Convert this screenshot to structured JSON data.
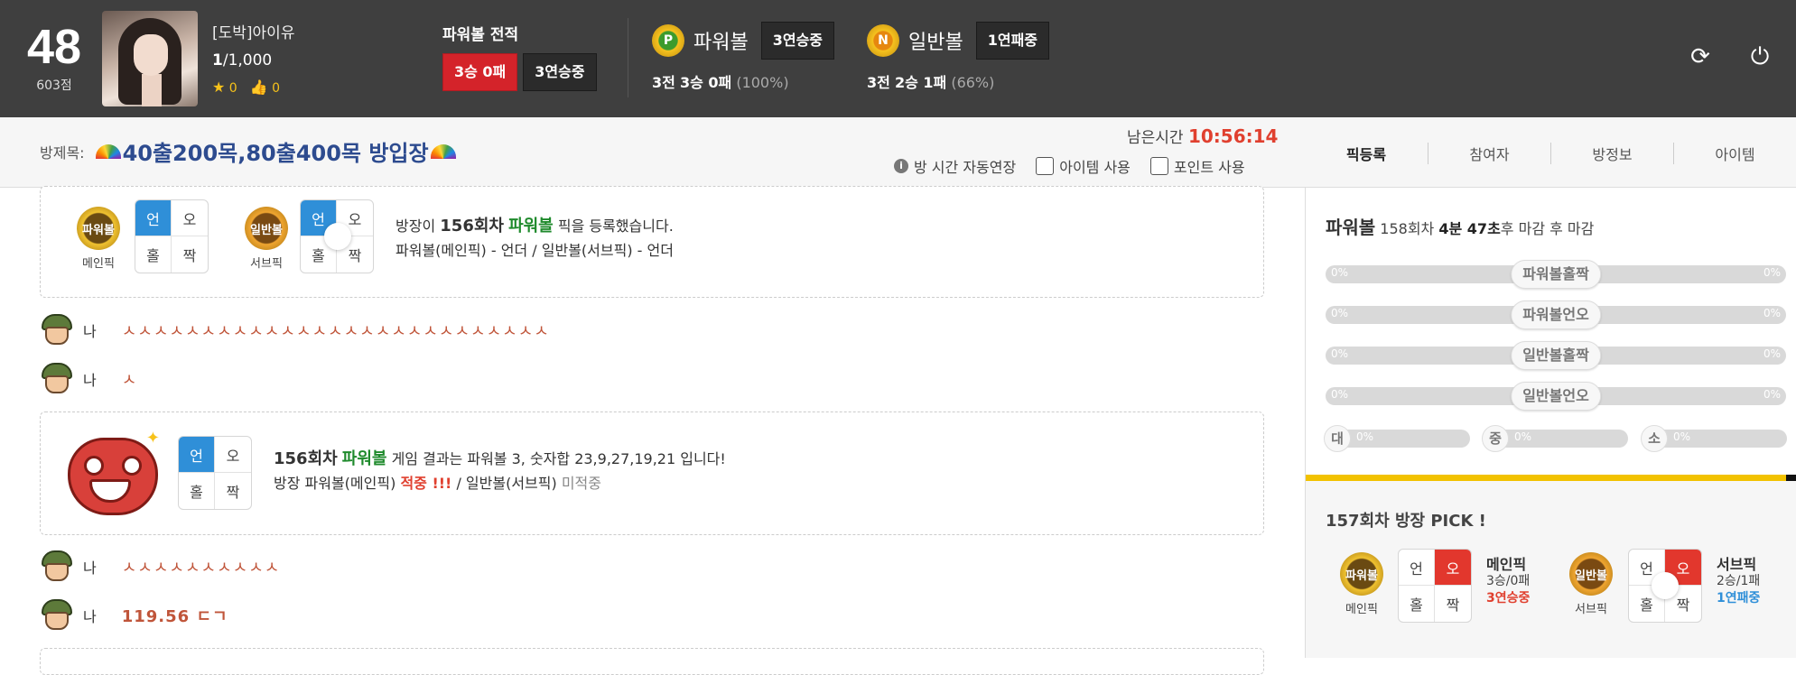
{
  "header": {
    "level": "48",
    "points": "603점",
    "user_name": "[도박]아이유",
    "rank_current": "1",
    "rank_total": "/1,000",
    "stars": "0",
    "likes": "0",
    "record_title": "파워볼 전적",
    "record_result": "3승 0패",
    "record_streak": "3연승중",
    "powerball": {
      "coin": "P",
      "name": "파워볼",
      "streak": "3연승중",
      "stat_prefix": "3전",
      "stat_main": "3승 0패",
      "pct": "(100%)"
    },
    "normalball": {
      "coin": "N",
      "name": "일반볼",
      "streak": "1연패중",
      "stat_prefix": "3전",
      "stat_main": "2승 1패",
      "pct": "(66%)"
    }
  },
  "room": {
    "label": "방제목:",
    "title": "40출200목,80출400목 방입장",
    "time_label": "남은시간",
    "time_value": "10:56:14",
    "auto_extend": "방 시간 자동연장",
    "use_item": "아이템 사용",
    "use_point": "포인트 사용",
    "tabs": [
      "픽등록",
      "참여자",
      "방정보",
      "아이템"
    ]
  },
  "chat": {
    "pick_card": {
      "main_ball": "파워볼",
      "main_caption": "메인픽",
      "sub_ball": "일반볼",
      "sub_caption": "서브픽",
      "grid": [
        "언",
        "오",
        "홀",
        "짝"
      ],
      "line1_a": "방장이",
      "line1_round": "156회차",
      "line1_ball": "파워볼",
      "line1_b": "픽을 등록했습니다.",
      "line2": "파워볼(메인픽) - 언더 / 일반볼(서브픽) - 언더"
    },
    "messages": [
      {
        "who": "나",
        "text": "ㅅㅅㅅㅅㅅㅅㅅㅅㅅㅅㅅㅅㅅㅅㅅㅅㅅㅅㅅㅅㅅㅅㅅㅅㅅㅅㅅ"
      },
      {
        "who": "나",
        "text": "ㅅ"
      },
      {
        "who": "나",
        "text": "ㅅㅅㅅㅅㅅㅅㅅㅅㅅㅅ"
      },
      {
        "who": "나",
        "text": "119.56 ㄷㄱ"
      }
    ],
    "result_card": {
      "grid": [
        "언",
        "오",
        "홀",
        "짝"
      ],
      "round": "156회차",
      "ball": "파워볼",
      "text": "게임 결과는 파워볼 3, 숫자합 23,9,27,19,21 입니다!",
      "line2_a": "방장 파워볼(메인픽)",
      "line2_hit": "적중 !!!",
      "line2_b": "/ 일반볼(서브픽)",
      "line2_miss": "미적중"
    }
  },
  "panel": {
    "ball": "파워볼",
    "round": "158회차",
    "countdown": "4분 47초",
    "countdown_suffix": "후 마감 후 마감",
    "bars": [
      {
        "label": "파워볼홀짝",
        "left": "0%",
        "right": "0%"
      },
      {
        "label": "파워볼언오",
        "left": "0%",
        "right": "0%"
      },
      {
        "label": "일반볼홀짝",
        "left": "0%",
        "right": "0%"
      },
      {
        "label": "일반볼언오",
        "left": "0%",
        "right": "0%"
      }
    ],
    "sizes": [
      {
        "label": "대",
        "value": "0%"
      },
      {
        "label": "중",
        "value": "0%"
      },
      {
        "label": "소",
        "value": "0%"
      }
    ],
    "pick_title": "157회차 방장 PICK !",
    "main": {
      "ball": "파워볼",
      "caption": "메인픽",
      "head": "메인픽",
      "record": "3승/0패",
      "streak": "3연승중"
    },
    "sub": {
      "ball": "일반볼",
      "caption": "서브픽",
      "head": "서브픽",
      "record": "2승/1패",
      "streak": "1연패중"
    },
    "grid": [
      "언",
      "오",
      "홀",
      "짝"
    ]
  },
  "colors": {
    "topbar": "#3f3f3f",
    "accent_red": "#d4232a",
    "accent_blue": "#2f8fd8",
    "title_blue": "#2d4b8f",
    "yellow": "#f2c200"
  }
}
